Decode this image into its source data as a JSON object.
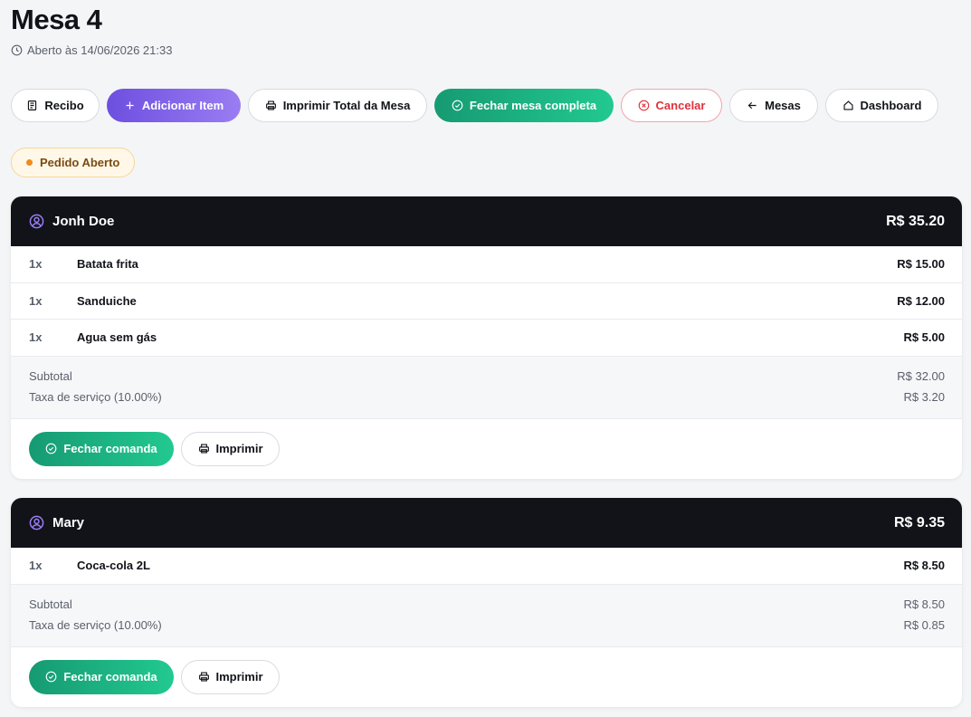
{
  "page": {
    "title": "Mesa 4",
    "opened_text": "Aberto às 14/06/2026 21:33"
  },
  "toolbar": {
    "receipt": "Recibo",
    "add_item": "Adicionar Item",
    "print_total": "Imprimir Total da Mesa",
    "close_table": "Fechar mesa completa",
    "cancel": "Cancelar",
    "tables": "Mesas",
    "dashboard": "Dashboard"
  },
  "status_badge": "Pedido Aberto",
  "colors": {
    "accent_purple": "#6d4fe0",
    "accent_green": "#169a72",
    "danger": "#e0313a",
    "header_dark": "#111318",
    "badge_bg": "#fff8e8"
  },
  "orders": [
    {
      "customer": "Jonh Doe",
      "total": "R$ 35.20",
      "items": [
        {
          "qty": "1x",
          "name": "Batata frita",
          "price": "R$ 15.00"
        },
        {
          "qty": "1x",
          "name": "Sanduiche",
          "price": "R$ 12.00"
        },
        {
          "qty": "1x",
          "name": "Agua sem gás",
          "price": "R$ 5.00"
        }
      ],
      "subtotal_label": "Subtotal",
      "subtotal": "R$ 32.00",
      "service_label": "Taxa de serviço (10.00%)",
      "service": "R$ 3.20",
      "close_label": "Fechar comanda",
      "print_label": "Imprimir"
    },
    {
      "customer": "Mary",
      "total": "R$ 9.35",
      "items": [
        {
          "qty": "1x",
          "name": "Coca-cola 2L",
          "price": "R$ 8.50"
        }
      ],
      "subtotal_label": "Subtotal",
      "subtotal": "R$ 8.50",
      "service_label": "Taxa de serviço (10.00%)",
      "service": "R$ 0.85",
      "close_label": "Fechar comanda",
      "print_label": "Imprimir"
    }
  ]
}
